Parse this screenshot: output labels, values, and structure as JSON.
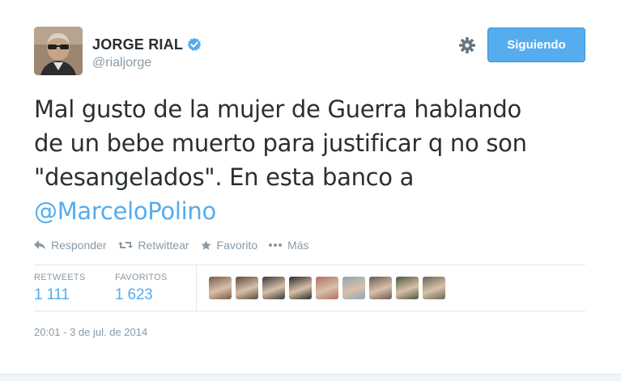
{
  "tweet": {
    "display_name": "JORGE RIAL",
    "handle": "@rialjorge",
    "verified": true,
    "follow_button_label": "Siguiendo",
    "text_lines": [
      "Mal gusto de la mujer de Guerra hablando",
      "de un bebe muerto para justificar q no son",
      "\"desangelados\". En esta banco a"
    ],
    "mention": "@MarceloPolino",
    "timestamp": "20:01 - 3 de jul. de 2014"
  },
  "actions": {
    "reply": "Responder",
    "retweet": "Retwittear",
    "favorite": "Favorito",
    "more": "Más"
  },
  "stats": {
    "retweets_label": "RETWEETS",
    "retweets_value": "1 111",
    "favorites_label": "FAVORITOS",
    "favorites_value": "1 623"
  },
  "favoriters": [
    "#7a5a48",
    "#5b4a3e",
    "#3a3a3a",
    "#2a2a2a",
    "#b07060",
    "#8fa6b5",
    "#6a5a50",
    "#4a5a42",
    "#6a6456"
  ],
  "colors": {
    "accent": "#55acee",
    "muted": "#8899a6",
    "text": "#292f33"
  }
}
